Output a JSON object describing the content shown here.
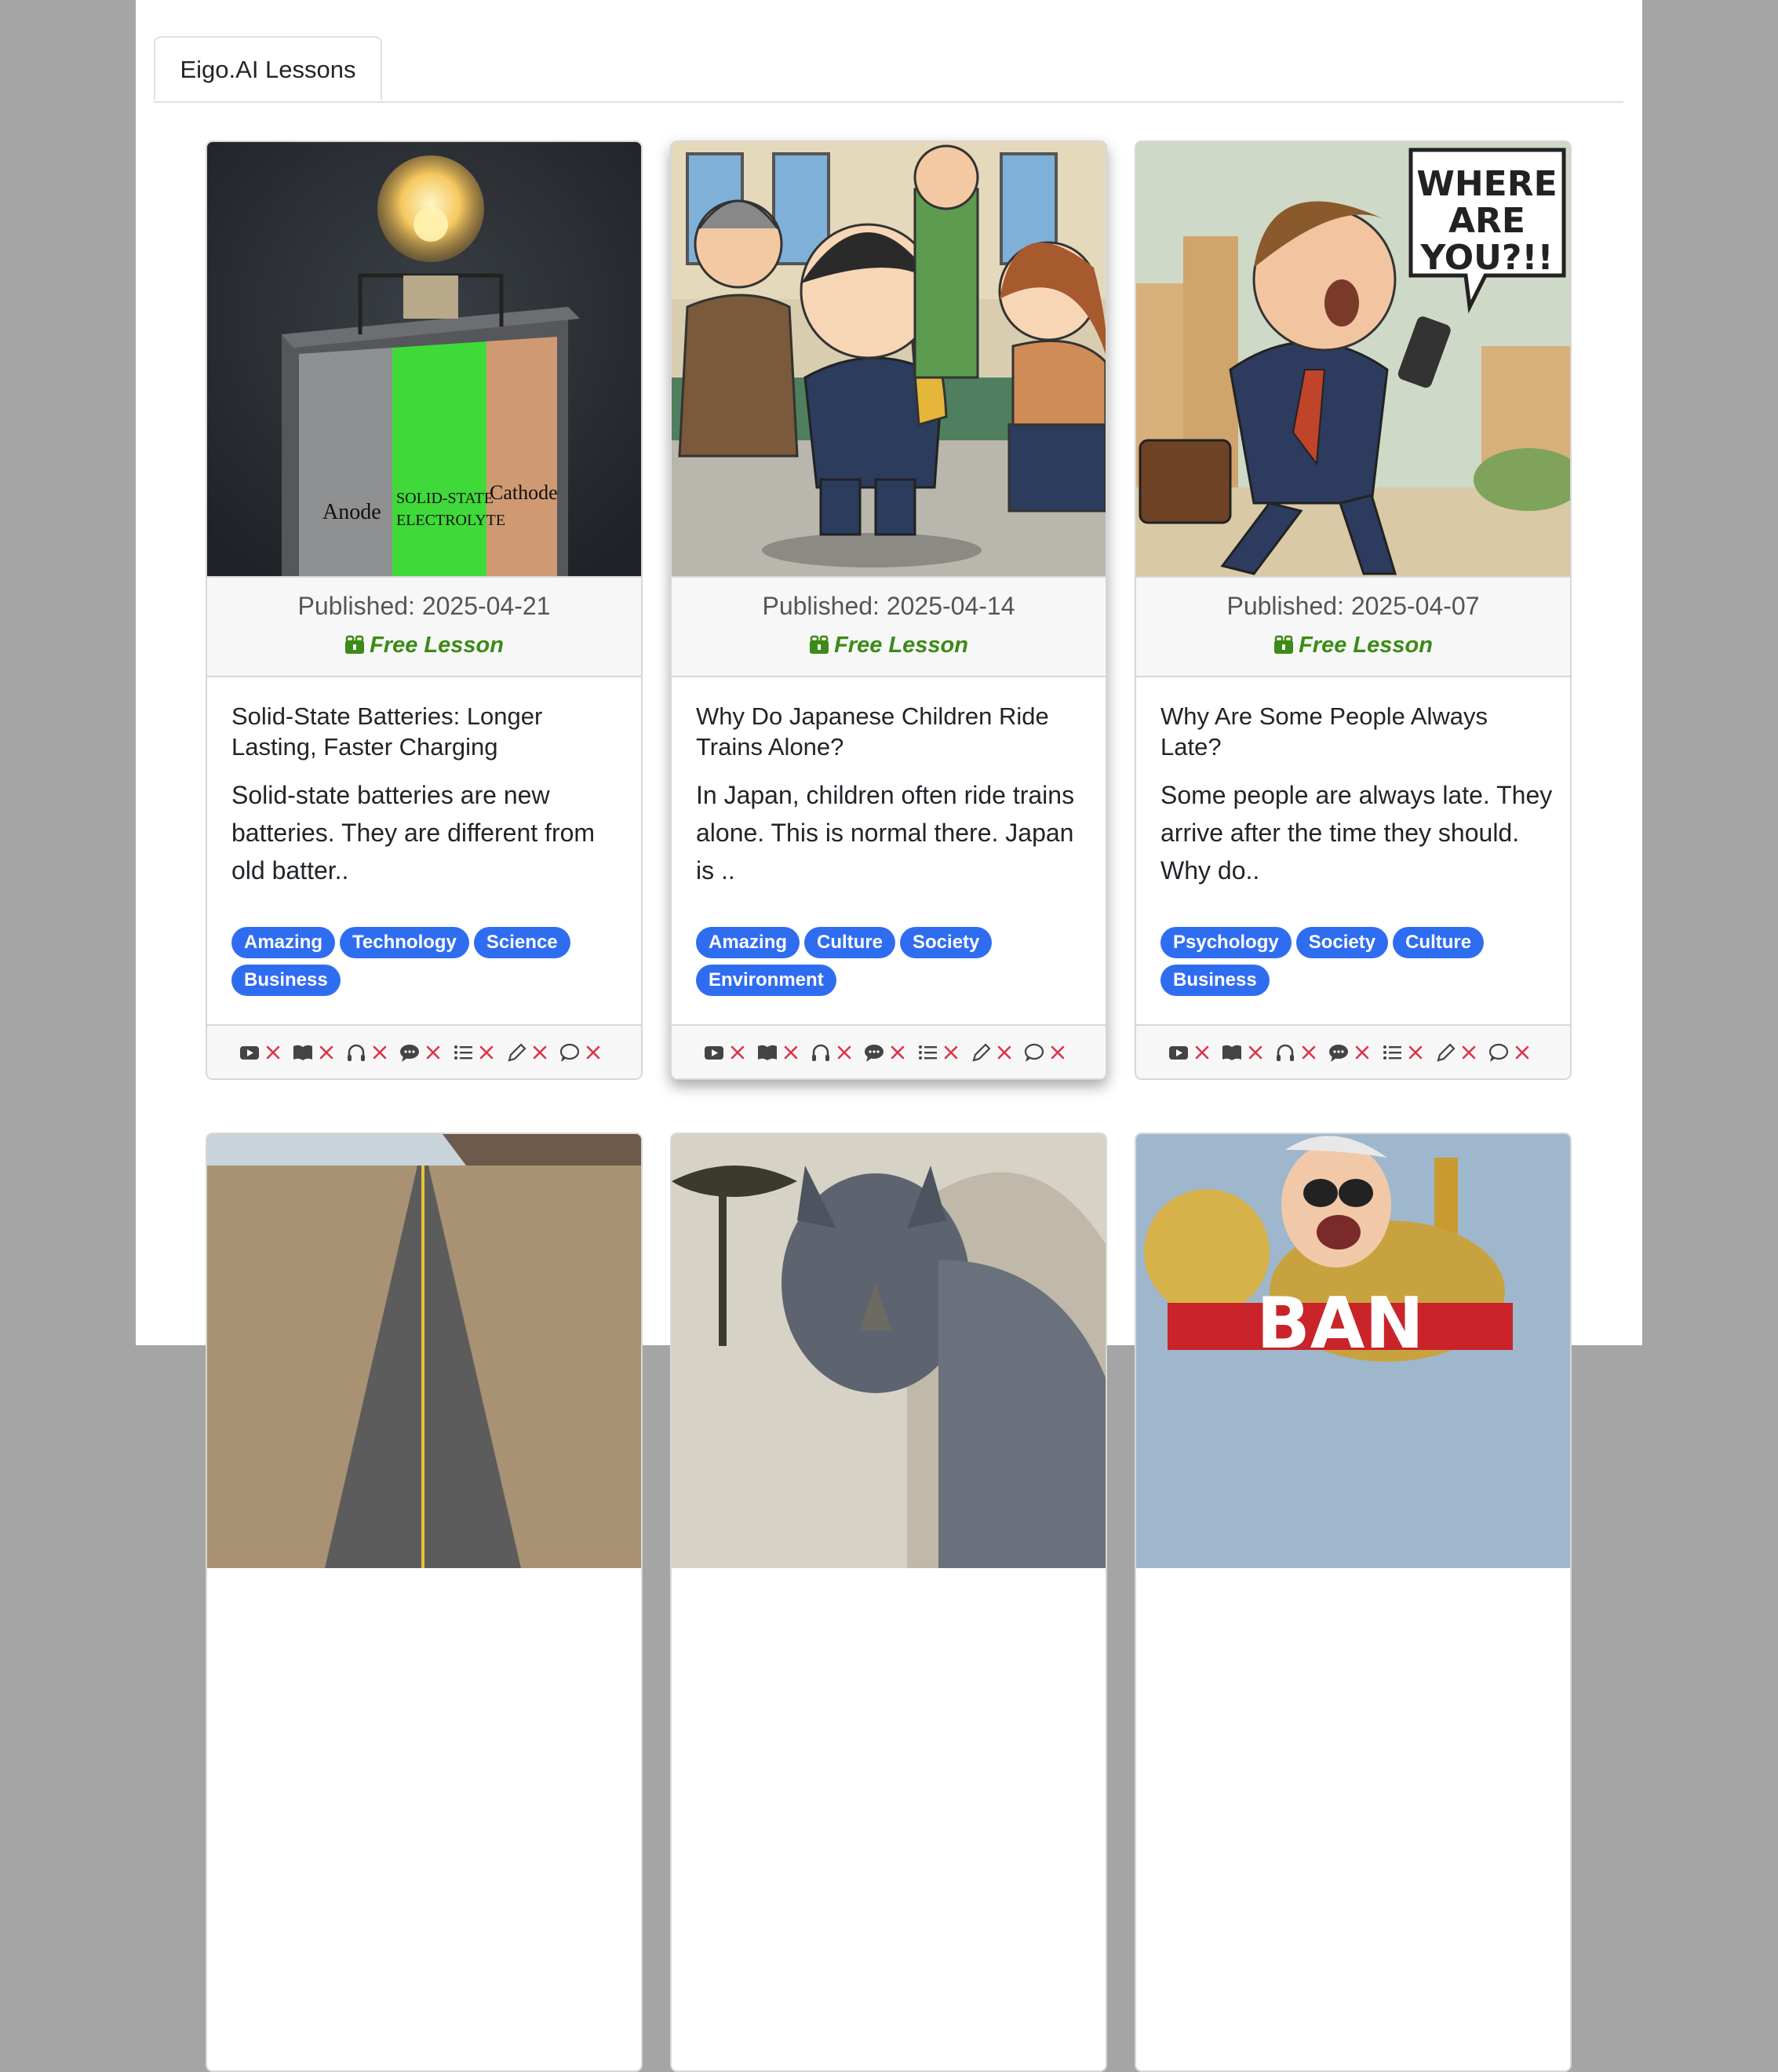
{
  "tabs": [
    {
      "label": "Eigo.AI Lessons"
    }
  ],
  "colors": {
    "accent": "#2f6df0",
    "free": "#3c8a17",
    "cross": "#dc3545"
  },
  "lessons": [
    {
      "published": "Published: 2025-04-21",
      "free_label": "Free Lesson",
      "title": "Solid-State Batteries: Longer Lasting, Faster Charging",
      "description": "Solid-state batteries are new batteries. They are different from old batter..",
      "tags": [
        "Amazing",
        "Technology",
        "Science",
        "Business"
      ],
      "image_text": {
        "anode": "Anode",
        "electrolyte_1": "SOLID-STATE",
        "electrolyte_2": "ELECTROLYTE",
        "cathode": "Cathode"
      }
    },
    {
      "published": "Published: 2025-04-14",
      "free_label": "Free Lesson",
      "title": "Why Do Japanese Children Ride Trains Alone?",
      "description": "In Japan, children often ride trains alone. This is normal there. Japan is ..",
      "tags": [
        "Amazing",
        "Culture",
        "Society",
        "Environment"
      ]
    },
    {
      "published": "Published: 2025-04-07",
      "free_label": "Free Lesson",
      "title": "Why Are Some People Always Late?",
      "description": "Some people are always late. They arrive after the time they should. Why do..",
      "tags": [
        "Psychology",
        "Society",
        "Culture",
        "Business"
      ],
      "image_text": {
        "bubble_1": "WHERE",
        "bubble_2": "ARE",
        "bubble_3": "YOU?!!"
      }
    }
  ],
  "status_icons": [
    "video-icon",
    "book-icon",
    "headphones-icon",
    "chat-icon",
    "list-icon",
    "pencil-icon",
    "comment-icon"
  ],
  "row2_images": {
    "ban_text": "BAN"
  }
}
